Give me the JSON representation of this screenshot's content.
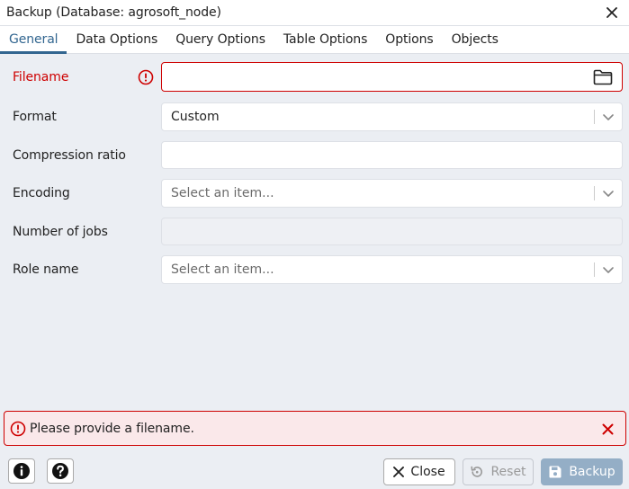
{
  "window": {
    "title": "Backup (Database: agrosoft_node)"
  },
  "tabs": [
    {
      "label": "General",
      "active": true
    },
    {
      "label": "Data Options",
      "active": false
    },
    {
      "label": "Query Options",
      "active": false
    },
    {
      "label": "Table Options",
      "active": false
    },
    {
      "label": "Options",
      "active": false
    },
    {
      "label": "Objects",
      "active": false
    }
  ],
  "form": {
    "filename": {
      "label": "Filename",
      "value": "",
      "error": true
    },
    "format": {
      "label": "Format",
      "value": "Custom"
    },
    "compression_ratio": {
      "label": "Compression ratio",
      "value": ""
    },
    "encoding": {
      "label": "Encoding",
      "placeholder": "Select an item..."
    },
    "number_of_jobs": {
      "label": "Number of jobs",
      "value": "",
      "disabled": true
    },
    "role_name": {
      "label": "Role name",
      "placeholder": "Select an item..."
    }
  },
  "banner": {
    "message": "Please provide a filename."
  },
  "footer": {
    "close_label": "Close",
    "reset_label": "Reset",
    "backup_label": "Backup"
  },
  "icons": {
    "info": "info-icon",
    "help": "help-icon",
    "error": "error-circle-icon",
    "folder": "folder-icon",
    "close": "close-icon",
    "chevron": "chevron-down-icon",
    "reset": "reset-icon",
    "save": "save-icon"
  },
  "colors": {
    "accent": "#326690",
    "error": "#ce0000",
    "background": "#ebeef3",
    "banner_background": "#fae8ea",
    "backup_disabled": "#94aec6"
  }
}
